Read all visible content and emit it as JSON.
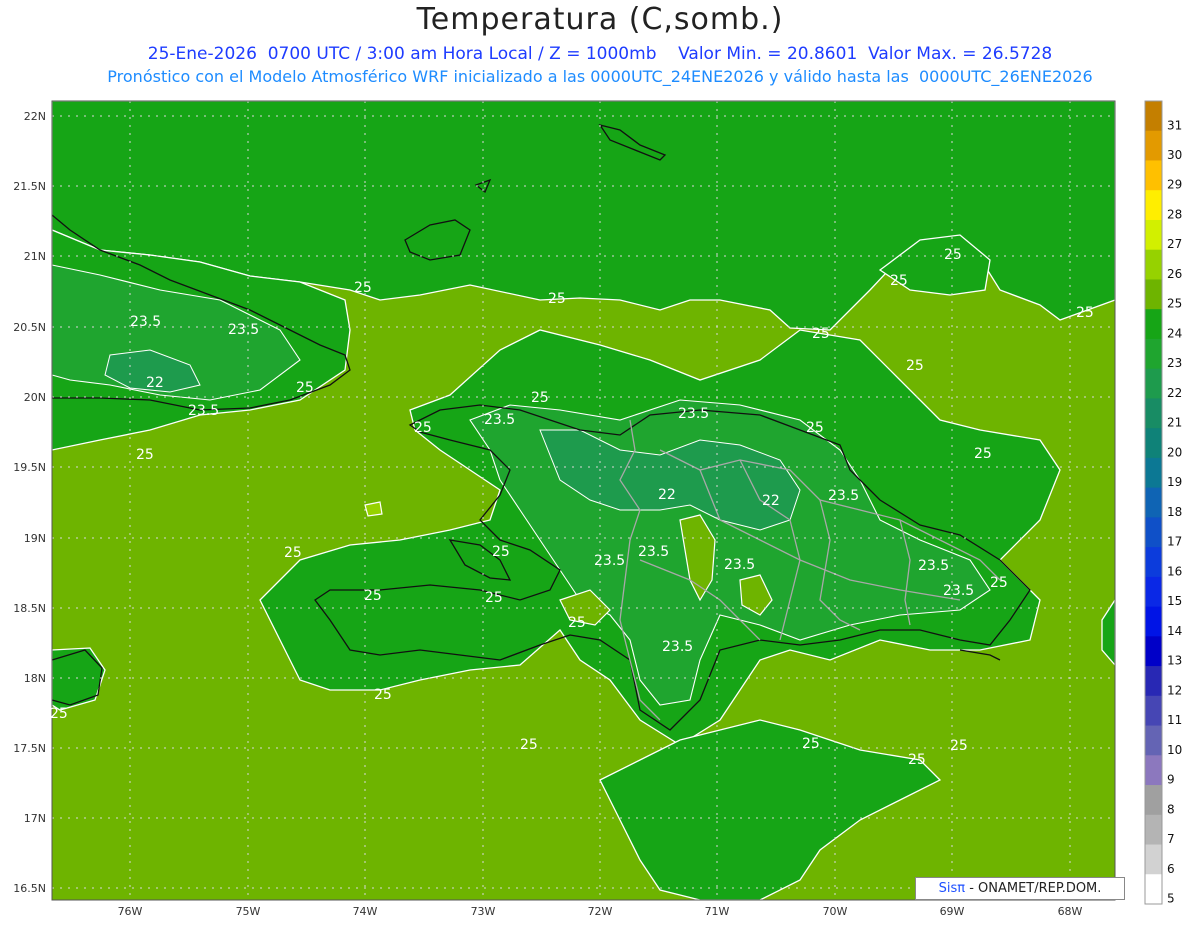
{
  "header": {
    "title": "Temperatura (C,somb.)",
    "line1": "25-Ene-2026  0700 UTC / 3:00 am Hora Local / Z = 1000mb    Valor Min. = 20.8601  Valor Max. = 26.5728",
    "line2": "Pronóstico con el Modelo Atmosférico WRF inicializado a las 0000UTC_24ENE2026 y válido hasta las  0000UTC_26ENE2026"
  },
  "axes": {
    "lat_labels": [
      "22N",
      "21.5N",
      "21N",
      "20.5N",
      "20N",
      "19.5N",
      "19N",
      "18.5N",
      "18N",
      "17.5N",
      "17N",
      "16.5N"
    ],
    "lon_labels": [
      "76W",
      "75W",
      "74W",
      "73W",
      "72W",
      "71W",
      "70W",
      "69W",
      "68W"
    ]
  },
  "colorbar": {
    "levels": [
      "31",
      "30",
      "29",
      "28",
      "27",
      "26",
      "25",
      "24",
      "23",
      "22",
      "21",
      "20",
      "19",
      "18",
      "17",
      "16",
      "15",
      "14",
      "13",
      "12",
      "11",
      "10",
      "9",
      "8",
      "7",
      "6",
      "5"
    ],
    "colors": [
      "#c47f00",
      "#e39a00",
      "#ffc000",
      "#ffee00",
      "#d2f000",
      "#96d200",
      "#6eb400",
      "#16a516",
      "#1fa52f",
      "#1e9b4d",
      "#188c64",
      "#0f8278",
      "#0c7894",
      "#0f64b4",
      "#0f50c8",
      "#0c3cdc",
      "#0a28e6",
      "#0014e6",
      "#0000c8",
      "#2828b4",
      "#4646b4",
      "#6464b4",
      "#8c78be",
      "#a0a0a0",
      "#b4b4b4",
      "#d2d2d2",
      "#ffffff"
    ]
  },
  "contour_labels": [
    "25",
    "25",
    "25",
    "25",
    "25",
    "25",
    "25",
    "25",
    "25",
    "25",
    "25",
    "25",
    "25",
    "25",
    "25",
    "25",
    "25",
    "25",
    "25",
    "25",
    "25",
    "25",
    "25",
    "25",
    "25",
    "23.5",
    "23.5",
    "23.5",
    "23.5",
    "23.5",
    "23.5",
    "23.5",
    "23.5",
    "23.5",
    "23.5",
    "23.5",
    "23.5",
    "22",
    "22",
    "22"
  ],
  "credit": {
    "brand": "Sisπ",
    "text": " - ONAMET/REP.DOM."
  }
}
